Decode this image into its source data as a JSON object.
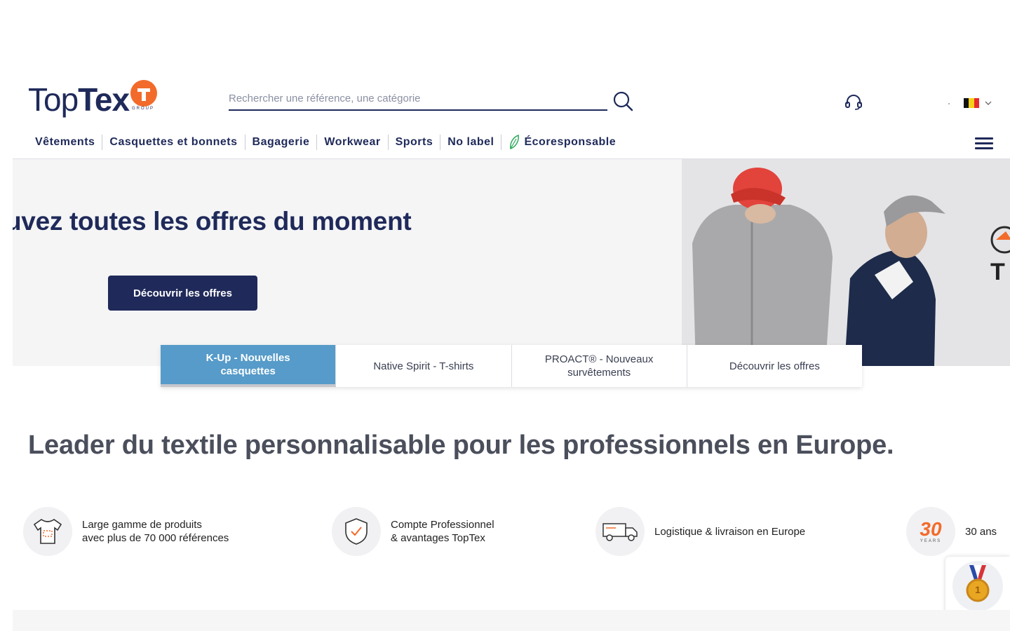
{
  "header": {
    "logo": {
      "text_light": "Top",
      "text_bold": "Tex",
      "badge_letter": "T",
      "sub": "GROUP"
    },
    "search": {
      "placeholder": "Rechercher une référence, une catégorie",
      "value": ""
    },
    "icons": {
      "search": "search-icon",
      "support": "headset-icon",
      "language": "belgium-flag-icon",
      "menu": "hamburger-icon"
    },
    "colors": {
      "brand_navy": "#1f2a5a",
      "brand_orange": "#f26b2b"
    }
  },
  "nav": {
    "items": [
      {
        "label": "Vêtements"
      },
      {
        "label": "Casquettes et bonnets"
      },
      {
        "label": "Bagagerie"
      },
      {
        "label": "Workwear"
      },
      {
        "label": "Sports"
      },
      {
        "label": "No label"
      },
      {
        "label": "Écoresponsable",
        "icon": "leaf-icon"
      }
    ]
  },
  "hero": {
    "title": "uvez toutes les offres du moment",
    "button": "Découvrir les offres",
    "image_side_text": "T"
  },
  "tabs": [
    {
      "label": "K-Up - Nouvelles casquettes",
      "active": true
    },
    {
      "label": "Native Spirit - T-shirts",
      "active": false
    },
    {
      "label": "PROACT® - Nouveaux survêtements",
      "active": false
    },
    {
      "label": "Découvrir les offres",
      "active": false
    }
  ],
  "leader": {
    "title": "Leader du textile personnalisable pour les professionnels en Europe."
  },
  "features": [
    {
      "line1": "Large gamme de produits",
      "line2": "avec plus de 70 000 références",
      "icon": "tshirt-icon"
    },
    {
      "line1": "Compte Professionnel",
      "line2": "& avantages TopTex",
      "icon": "shield-check-icon"
    },
    {
      "line1": "Logistique & livraison en Europe",
      "line2": "",
      "icon": "truck-icon"
    },
    {
      "line1": "30 ans",
      "line2": "",
      "icon": "30-years-icon",
      "badge": "30",
      "badge_sub": "YEARS"
    }
  ],
  "medal": {
    "icon": "medal-icon",
    "number": "1"
  }
}
